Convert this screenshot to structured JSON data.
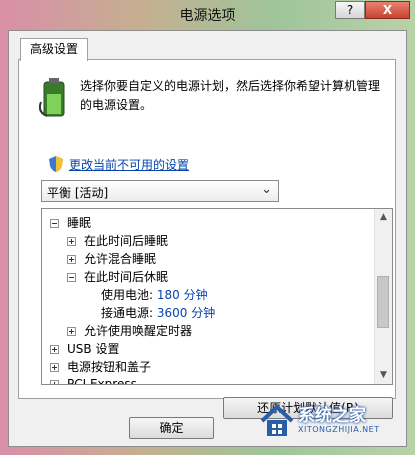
{
  "window": {
    "title": "电源选项",
    "help_label": "?",
    "close_label": "X"
  },
  "tab": {
    "label": "高级设置"
  },
  "intro": {
    "text": "选择你要自定义的电源计划，然后选择你希望计算机管理的电源设置。"
  },
  "change_link": "更改当前不可用的设置",
  "plan_select": {
    "value": "平衡 [活动]"
  },
  "tree": {
    "items": [
      {
        "label": "睡眠",
        "expander": "minus"
      },
      {
        "label": "在此时间后睡眠",
        "expander": "plus"
      },
      {
        "label": "允许混合睡眠",
        "expander": "plus"
      },
      {
        "label": "在此时间后休眠",
        "expander": "minus"
      },
      {
        "label": "使用电池:",
        "value": "180 分钟"
      },
      {
        "label": "接通电源:",
        "value": "3600 分钟"
      },
      {
        "label": "允许使用唤醒定时器",
        "expander": "plus"
      },
      {
        "label": "USB 设置",
        "expander": "plus"
      },
      {
        "label": "电源按钮和盖子",
        "expander": "plus"
      },
      {
        "label": "PCI Express",
        "expander": "plus"
      }
    ]
  },
  "restore_button": "还原计划默认值(R)",
  "ok_button": "确定",
  "watermark": {
    "title": "系统之家",
    "subtitle": "XITONGZHIJIA.NET"
  }
}
